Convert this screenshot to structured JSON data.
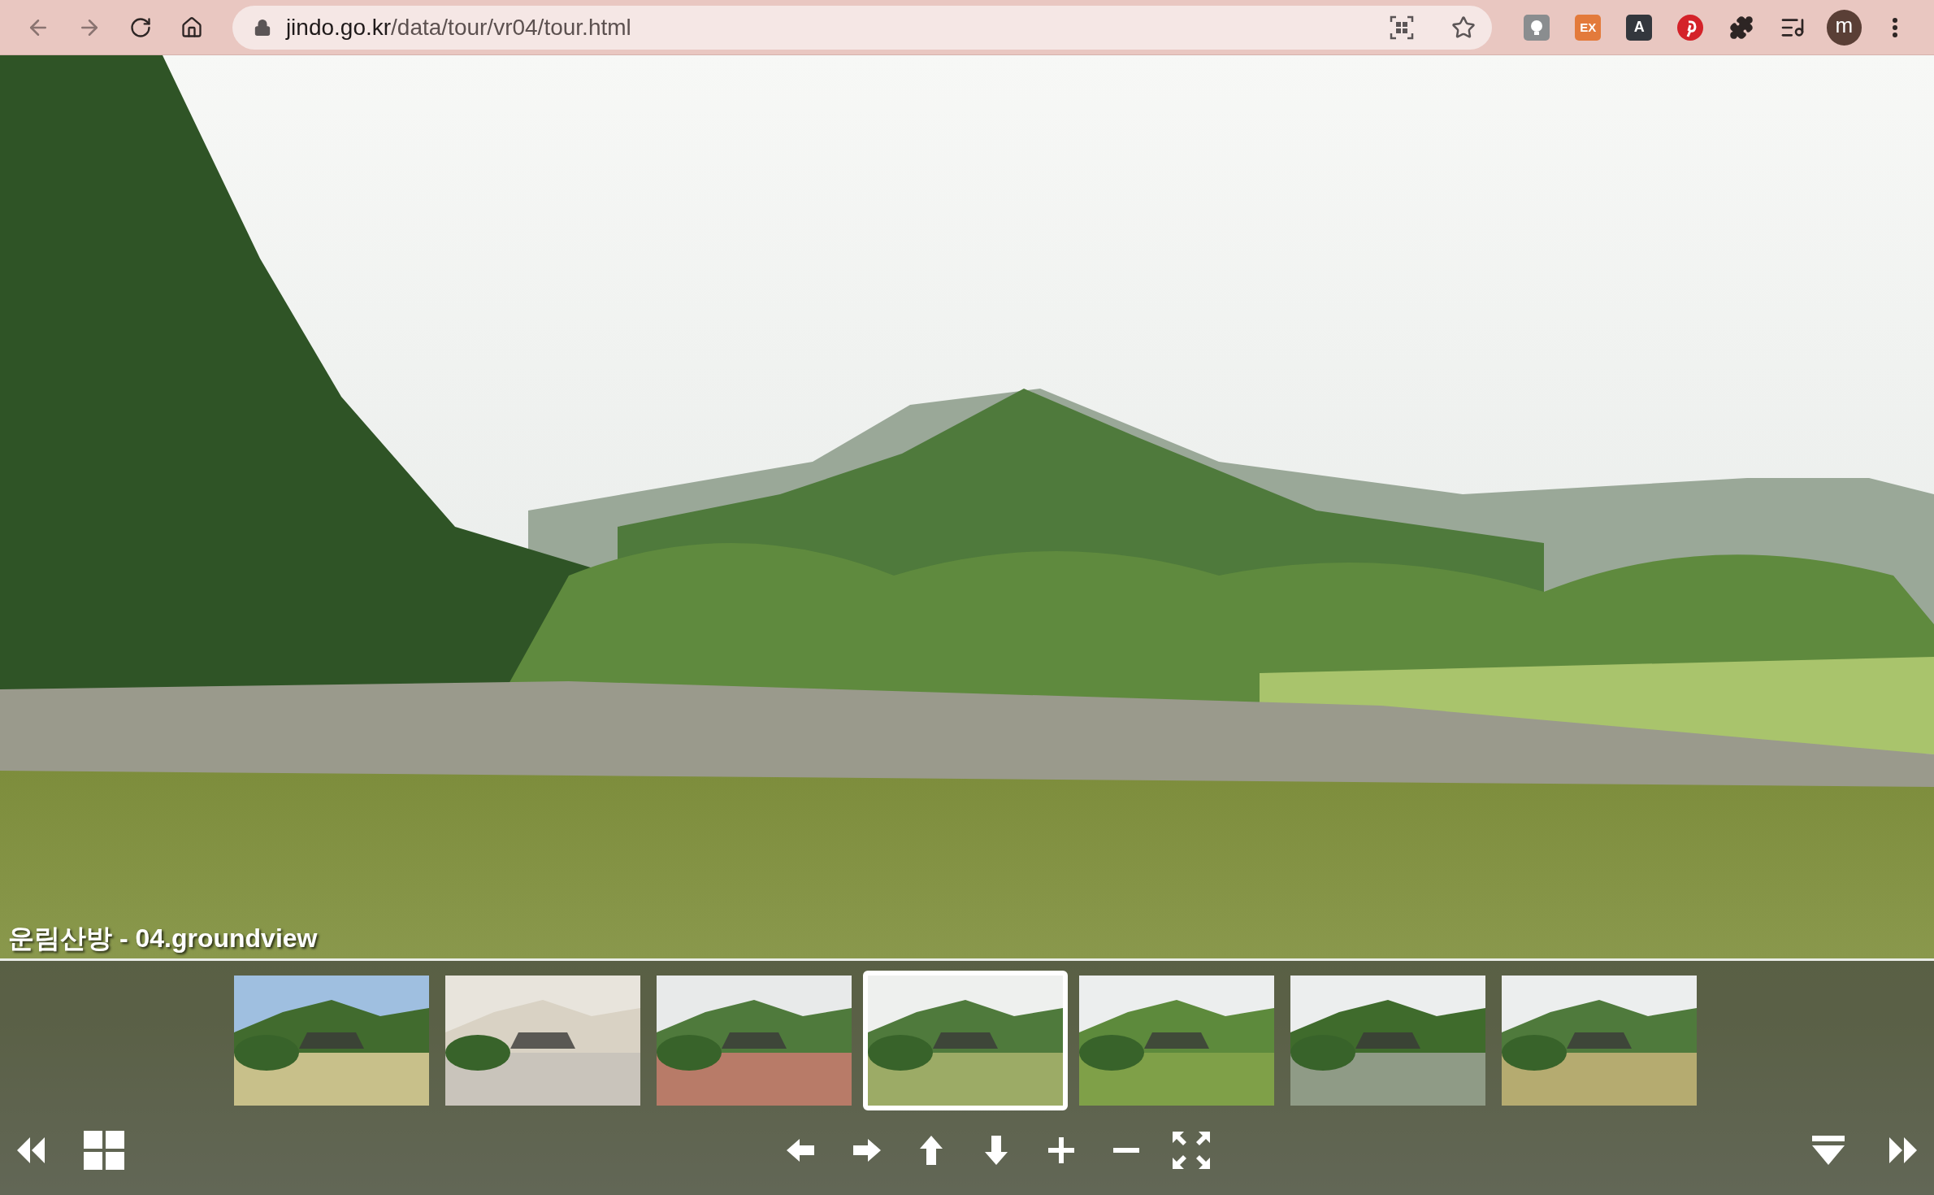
{
  "browser": {
    "url_host": "jindo.go.kr",
    "url_path": "/data/tour/vr04/tour.html",
    "extensions": [
      {
        "kind": "bulb"
      },
      {
        "kind": "ex",
        "label": "EX"
      },
      {
        "kind": "dict",
        "label": "A"
      },
      {
        "kind": "pin"
      },
      {
        "kind": "puzzle"
      },
      {
        "kind": "playlist"
      }
    ],
    "profile": "m"
  },
  "tour": {
    "scene_title": "운림산방 - 04.groundview",
    "thumbnails": [
      {
        "kind": "aerial",
        "selected": false
      },
      {
        "kind": "building",
        "selected": false
      },
      {
        "kind": "plaza",
        "selected": false
      },
      {
        "kind": "pond",
        "selected": true
      },
      {
        "kind": "lawn",
        "selected": false
      },
      {
        "kind": "hanok",
        "selected": false
      },
      {
        "kind": "garden",
        "selected": false
      }
    ]
  }
}
